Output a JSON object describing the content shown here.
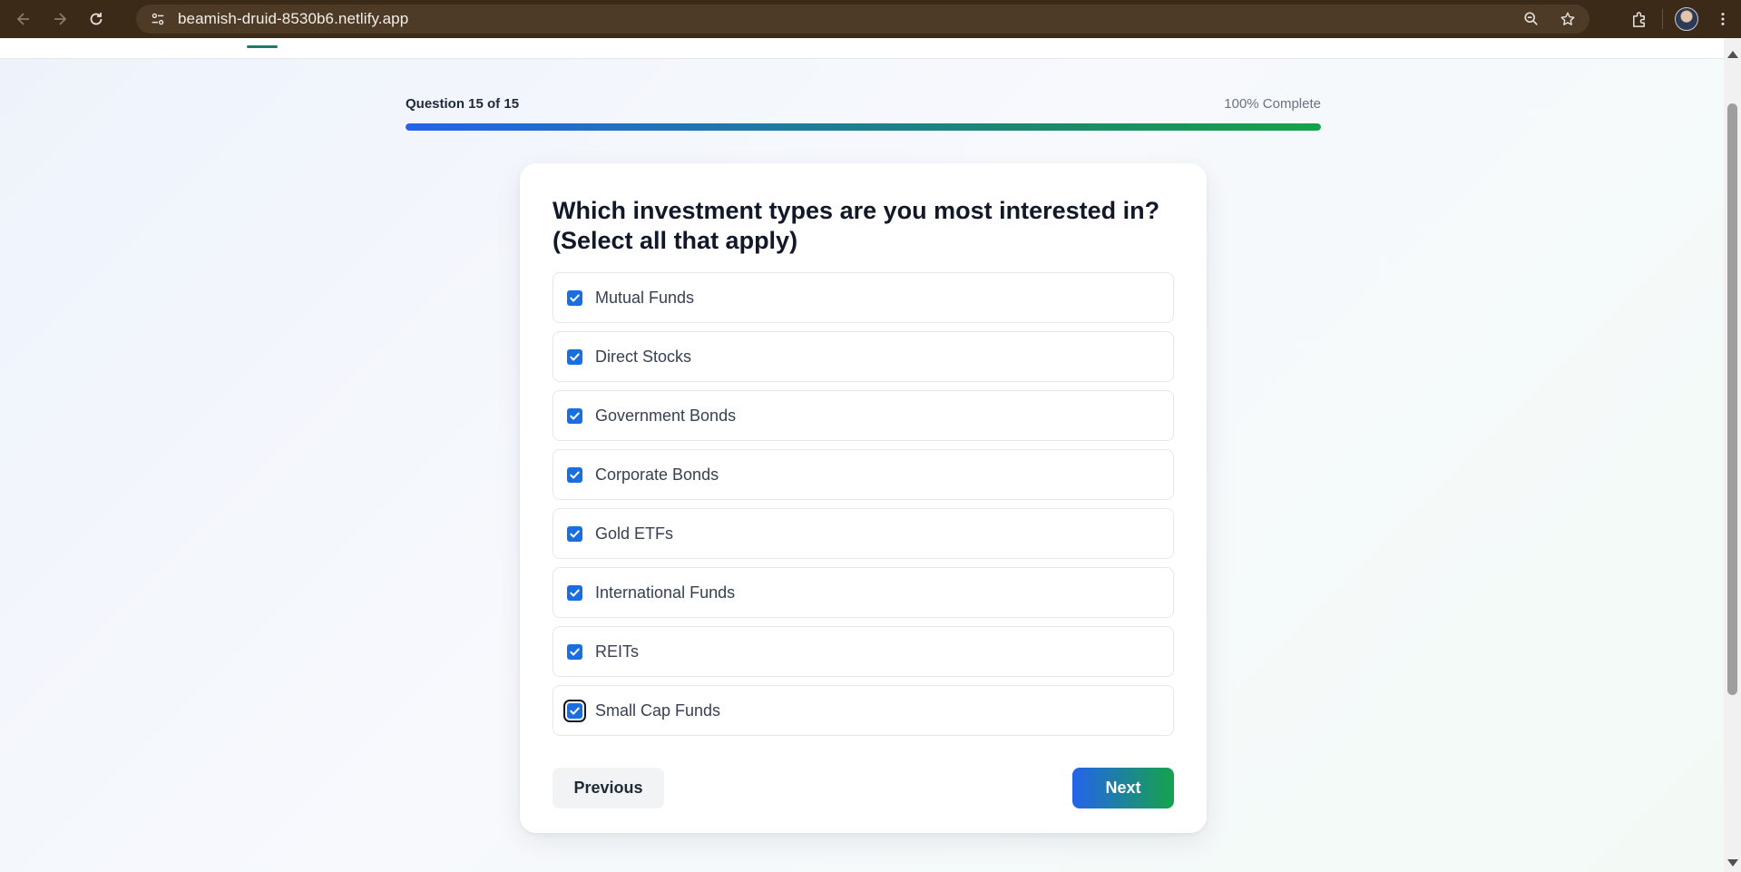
{
  "browser": {
    "url": "beamish-druid-8530b6.netlify.app"
  },
  "quiz": {
    "question_counter": "Question 15 of 15",
    "completion_label": "100% Complete",
    "progress_percent": 100,
    "question": "Which investment types are you most interested in? (Select all that apply)",
    "options": [
      {
        "label": "Mutual Funds",
        "checked": true
      },
      {
        "label": "Direct Stocks",
        "checked": true
      },
      {
        "label": "Government Bonds",
        "checked": true
      },
      {
        "label": "Corporate Bonds",
        "checked": true
      },
      {
        "label": "Gold ETFs",
        "checked": true
      },
      {
        "label": "International Funds",
        "checked": true
      },
      {
        "label": "REITs",
        "checked": true
      },
      {
        "label": "Small Cap Funds",
        "checked": true
      }
    ],
    "previous_label": "Previous",
    "next_label": "Next"
  },
  "colors": {
    "accent_blue": "#2563eb",
    "accent_green": "#16a34a",
    "checkbox": "#1a6fe0"
  }
}
